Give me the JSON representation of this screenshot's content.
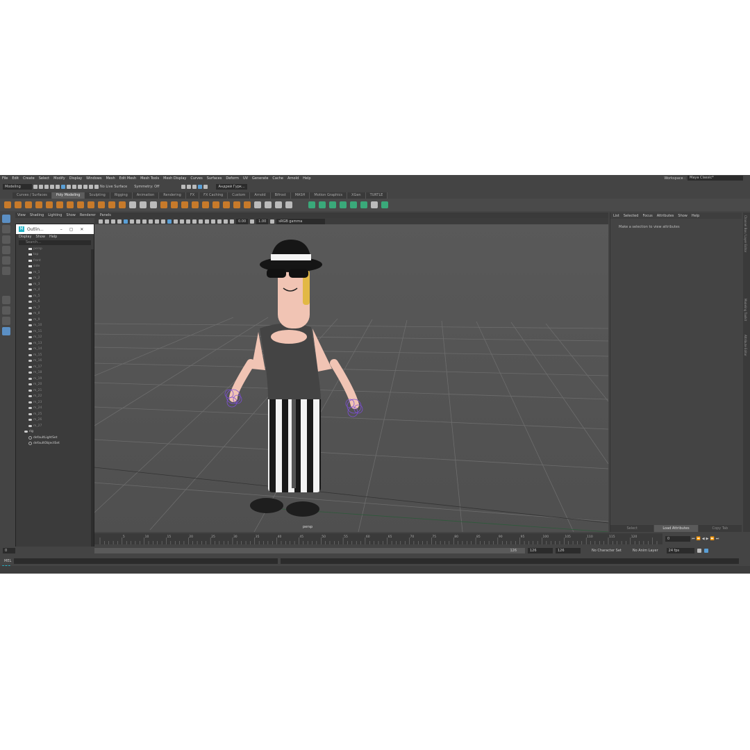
{
  "menubar": {
    "items": [
      "File",
      "Edit",
      "Create",
      "Select",
      "Modify",
      "Display",
      "Windows",
      "Mesh",
      "Edit Mesh",
      "Mesh Tools",
      "Mesh Display",
      "Curves",
      "Surfaces",
      "Deform",
      "UV",
      "Generate",
      "Cache",
      "Arnold",
      "Help"
    ],
    "workspace_label": "Workspace :",
    "workspace_value": "Maya Classic*"
  },
  "statusline": {
    "mode": "Modeling",
    "live_surface": "No Live Surface",
    "symmetry": "Symmetry: Off",
    "user": "Андрей Гурк..."
  },
  "shelf_tabs": [
    "Curves / Surfaces",
    "Poly Modeling",
    "Sculpting",
    "Rigging",
    "Animation",
    "Rendering",
    "FX",
    "FX Caching",
    "Custom",
    "Arnold",
    "Bifrost",
    "MASH",
    "Motion Graphics",
    "XGen",
    "TURTLE"
  ],
  "shelf_active": "Poly Modeling",
  "viewport": {
    "menu": [
      "View",
      "Shading",
      "Lighting",
      "Show",
      "Renderer",
      "Panels"
    ],
    "value_a": "0.00",
    "value_b": "1.00",
    "color_space": "sRGB gamma",
    "camera_label": "persp"
  },
  "outliner": {
    "title": "Outlin...",
    "menu": [
      "Display",
      "Show",
      "Help"
    ],
    "search": "Search...",
    "rows": [
      "persp",
      "top",
      "front",
      "side",
      "m_1",
      "m_2",
      "m_3",
      "m_4",
      "m_5",
      "m_6",
      "m_7",
      "m_8",
      "m_9",
      "m_10",
      "m_11",
      "m_12",
      "m_13",
      "m_14",
      "m_15",
      "m_16",
      "m_17",
      "m_18",
      "m_19",
      "m_20",
      "m_21",
      "m_22",
      "m_23",
      "m_24",
      "m_25",
      "m_26",
      "m_27",
      "rig",
      "defaultLightSet",
      "defaultObjectSet"
    ]
  },
  "attribute_editor": {
    "menu": [
      "List",
      "Selected",
      "Focus",
      "Attributes",
      "Show",
      "Help"
    ],
    "message": "Make a selection to view attributes",
    "buttons": [
      "Select",
      "Load Attributes",
      "Copy Tab"
    ],
    "side_tabs": [
      "Channel Box / Layer Editor",
      "Modeling Toolkit",
      "Attribute Editor"
    ]
  },
  "timeline": {
    "ticks": [
      5,
      10,
      15,
      20,
      25,
      30,
      35,
      40,
      45,
      50,
      55,
      60,
      65,
      70,
      75,
      80,
      85,
      90,
      95,
      100,
      105,
      110,
      115,
      120
    ],
    "current": "0"
  },
  "range": {
    "start": "0",
    "range_end": "126",
    "end_a": "126",
    "end_b": "126",
    "character_set": "No Character Set",
    "anim_layer": "No Anim Layer",
    "fps": "24 fps"
  },
  "cmd": {
    "label": "MEL"
  },
  "colors": {
    "ui_bg": "#444444",
    "viewport_bg": "#555555",
    "accent": "#5b8fc4",
    "shelf_orange": "#d98a2b"
  }
}
